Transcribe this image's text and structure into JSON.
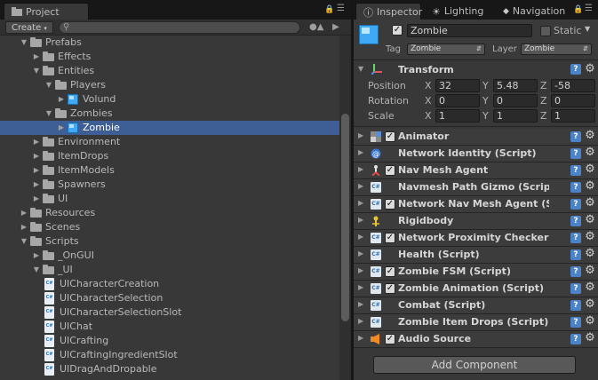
{
  "project": {
    "tab_label": "Project",
    "create_label": "Create",
    "search_value": "",
    "tree": [
      {
        "label": "Prefabs",
        "depth": 1,
        "type": "folder",
        "state": "open"
      },
      {
        "label": "Effects",
        "depth": 2,
        "type": "folder",
        "state": "closed"
      },
      {
        "label": "Entities",
        "depth": 2,
        "type": "folder",
        "state": "open"
      },
      {
        "label": "Players",
        "depth": 3,
        "type": "folder",
        "state": "open"
      },
      {
        "label": "Volund",
        "depth": 4,
        "type": "prefab",
        "state": "closed"
      },
      {
        "label": "Zombies",
        "depth": 3,
        "type": "folder",
        "state": "open"
      },
      {
        "label": "Zombie",
        "depth": 4,
        "type": "prefab",
        "state": "closed",
        "selected": true
      },
      {
        "label": "Environment",
        "depth": 2,
        "type": "folder",
        "state": "closed"
      },
      {
        "label": "ItemDrops",
        "depth": 2,
        "type": "folder",
        "state": "closed"
      },
      {
        "label": "ItemModels",
        "depth": 2,
        "type": "folder",
        "state": "closed"
      },
      {
        "label": "Spawners",
        "depth": 2,
        "type": "folder",
        "state": "closed"
      },
      {
        "label": "UI",
        "depth": 2,
        "type": "folder",
        "state": "closed"
      },
      {
        "label": "Resources",
        "depth": 1,
        "type": "folder",
        "state": "closed"
      },
      {
        "label": "Scenes",
        "depth": 1,
        "type": "folder",
        "state": "closed"
      },
      {
        "label": "Scripts",
        "depth": 1,
        "type": "folder",
        "state": "open"
      },
      {
        "label": "_OnGUI",
        "depth": 2,
        "type": "folder",
        "state": "closed"
      },
      {
        "label": "_UI",
        "depth": 2,
        "type": "folder",
        "state": "open"
      },
      {
        "label": "UICharacterCreation",
        "depth": 3,
        "type": "script",
        "state": "none"
      },
      {
        "label": "UICharacterSelection",
        "depth": 3,
        "type": "script",
        "state": "none"
      },
      {
        "label": "UICharacterSelectionSlot",
        "depth": 3,
        "type": "script",
        "state": "none"
      },
      {
        "label": "UIChat",
        "depth": 3,
        "type": "script",
        "state": "none"
      },
      {
        "label": "UICrafting",
        "depth": 3,
        "type": "script",
        "state": "none"
      },
      {
        "label": "UICraftingIngredientSlot",
        "depth": 3,
        "type": "script",
        "state": "none"
      },
      {
        "label": "UIDragAndDropable",
        "depth": 3,
        "type": "script",
        "state": "none"
      }
    ]
  },
  "inspector": {
    "tabs": [
      {
        "label": "Inspector",
        "icon": "info-icon",
        "active": true
      },
      {
        "label": "Lighting",
        "icon": "lighting-icon",
        "active": false
      },
      {
        "label": "Navigation",
        "icon": "navigation-icon",
        "active": false
      }
    ],
    "object_name": "Zombie",
    "active_checked": true,
    "static_label": "Static",
    "tag_label": "Tag",
    "tag_value": "Zombie",
    "layer_label": "Layer",
    "layer_value": "Zombie",
    "transform": {
      "title": "Transform",
      "rows": [
        {
          "label": "Position",
          "x": "32",
          "y": "5.48",
          "z": "-58"
        },
        {
          "label": "Rotation",
          "x": "0",
          "y": "0",
          "z": "0"
        },
        {
          "label": "Scale",
          "x": "1",
          "y": "1",
          "z": "1"
        }
      ],
      "axis_x": "X",
      "axis_y": "Y",
      "axis_z": "Z"
    },
    "components": [
      {
        "name": "Animator",
        "icon": "animator-icon",
        "checkbox": true
      },
      {
        "name": "Network Identity (Script)",
        "icon": "network-icon",
        "checkbox": false
      },
      {
        "name": "Nav Mesh Agent",
        "icon": "navmesh-agent-icon",
        "checkbox": true
      },
      {
        "name": "Navmesh Path Gizmo (Script)",
        "icon": "script-icon",
        "checkbox": false
      },
      {
        "name": "Network Nav Mesh Agent (Scri",
        "icon": "script-icon",
        "checkbox": true
      },
      {
        "name": "Rigidbody",
        "icon": "rigidbody-icon",
        "checkbox": false
      },
      {
        "name": "Network Proximity Checker Cu",
        "icon": "script-icon",
        "checkbox": true
      },
      {
        "name": "Health (Script)",
        "icon": "script-icon",
        "checkbox": false
      },
      {
        "name": "Zombie FSM (Script)",
        "icon": "script-icon",
        "checkbox": true
      },
      {
        "name": "Zombie Animation (Script)",
        "icon": "script-icon",
        "checkbox": true
      },
      {
        "name": "Combat (Script)",
        "icon": "script-icon",
        "checkbox": false
      },
      {
        "name": "Zombie Item Drops (Script)",
        "icon": "script-icon",
        "checkbox": false
      },
      {
        "name": "Audio Source",
        "icon": "audio-source-icon",
        "checkbox": true
      }
    ],
    "add_component_label": "Add Component"
  },
  "colors": {
    "selection": "#3e5f96",
    "panel_bg": "#383838",
    "accent_blue": "#3fa9f5"
  }
}
